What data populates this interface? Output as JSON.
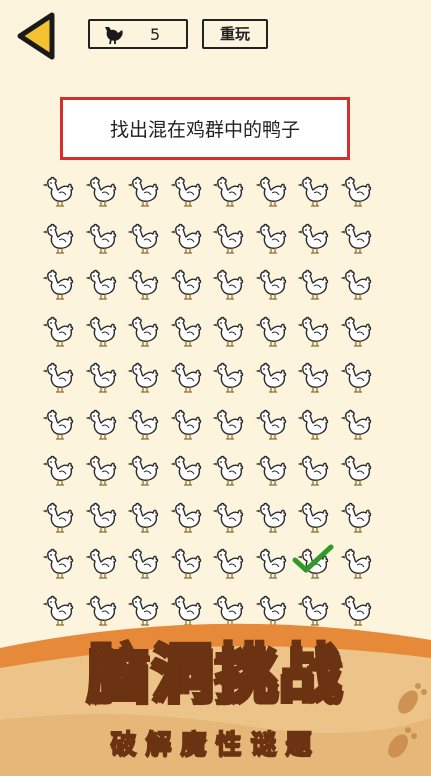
{
  "header": {
    "hint_count": "5",
    "replay_label": "重玩"
  },
  "instruction": "找出混在鸡群中的鸭子",
  "grid": {
    "columns": 8,
    "rows": 10,
    "found_duck": {
      "row": 9,
      "column": 7
    }
  },
  "banner": {
    "title": "脑洞挑战",
    "subtitle": "破解魔性谜题"
  },
  "colors": {
    "background": "#fdf4dd",
    "back_arrow": "#f2c230",
    "instruction_border": "#d62d2d",
    "checkmark": "#2f9a2a",
    "banner_top": "#e68a3a",
    "banner_sand": "#ecc388"
  },
  "icons": [
    "back-arrow-icon",
    "chicken-icon",
    "checkmark-icon",
    "footprint-icon"
  ]
}
